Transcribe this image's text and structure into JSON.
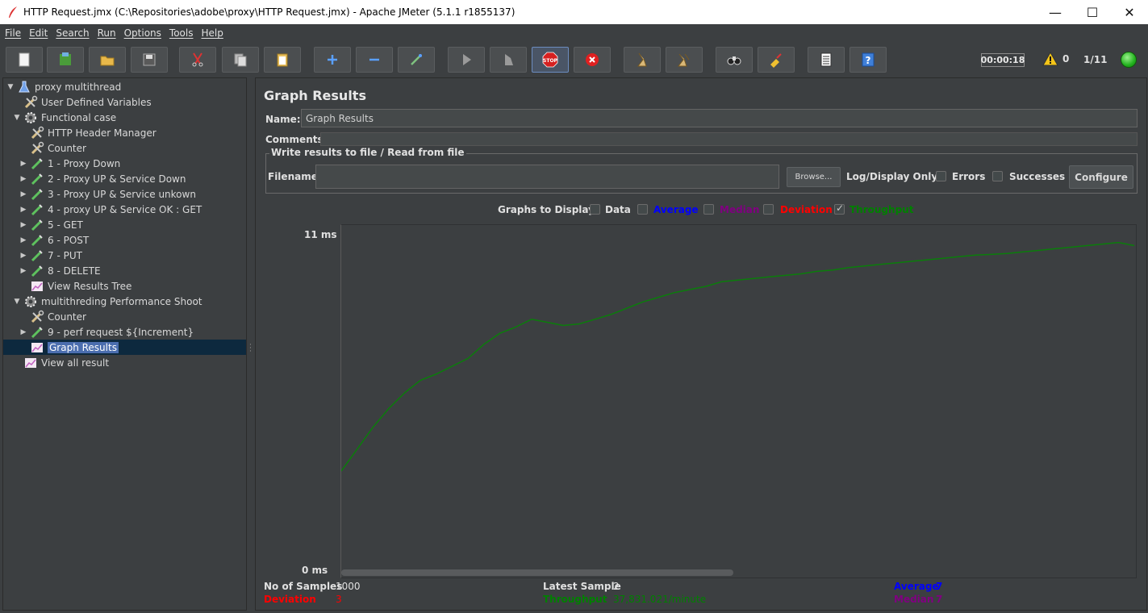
{
  "window": {
    "title": "HTTP Request.jmx (C:\\Repositories\\adobe\\proxy\\HTTP Request.jmx) - Apache JMeter (5.1.1 r1855137)",
    "minimize": "—",
    "maximize": "☐",
    "close": "✕"
  },
  "menu": [
    "File",
    "Edit",
    "Search",
    "Run",
    "Options",
    "Tools",
    "Help"
  ],
  "toolbar": {
    "buttons": [
      "new-icon",
      "templates-icon",
      "open-icon",
      "save-icon",
      "cut-icon",
      "copy-icon",
      "paste-icon",
      "expand-icon",
      "collapse-icon",
      "toggle-icon",
      "start-icon",
      "start-no-timers-icon",
      "stop-icon",
      "shutdown-icon",
      "clear-icon",
      "clear-all-icon",
      "search-icon",
      "reset-search-icon",
      "function-helper-icon",
      "help-icon"
    ],
    "timer": "00:00:18",
    "warnings": "0",
    "threads": "1/11"
  },
  "tree": [
    {
      "label": "proxy multithread",
      "level": 0,
      "toggle": "▼",
      "icon": "test-plan-icon"
    },
    {
      "label": "User Defined Variables",
      "level": 1,
      "toggle": "",
      "icon": "config-icon"
    },
    {
      "label": "Functional case",
      "level": 1,
      "toggle": "▼",
      "icon": "thread-group-icon"
    },
    {
      "label": "HTTP Header Manager",
      "level": 2,
      "toggle": "",
      "icon": "config-icon"
    },
    {
      "label": "Counter",
      "level": 2,
      "toggle": "",
      "icon": "config-icon"
    },
    {
      "label": "1 - Proxy Down",
      "level": 2,
      "toggle": "▶",
      "icon": "sampler-icon"
    },
    {
      "label": "2 - Proxy UP & Service Down",
      "level": 2,
      "toggle": "▶",
      "icon": "sampler-icon"
    },
    {
      "label": "3  - Proxy UP & Service unkown",
      "level": 2,
      "toggle": "▶",
      "icon": "sampler-icon"
    },
    {
      "label": "4 - proxy UP & Service OK : GET",
      "level": 2,
      "toggle": "▶",
      "icon": "sampler-icon"
    },
    {
      "label": "5 - GET",
      "level": 2,
      "toggle": "▶",
      "icon": "sampler-icon"
    },
    {
      "label": "6 - POST",
      "level": 2,
      "toggle": "▶",
      "icon": "sampler-icon"
    },
    {
      "label": "7  - PUT",
      "level": 2,
      "toggle": "▶",
      "icon": "sampler-icon"
    },
    {
      "label": "8 -  DELETE",
      "level": 2,
      "toggle": "▶",
      "icon": "sampler-icon"
    },
    {
      "label": "View Results Tree",
      "level": 2,
      "toggle": "",
      "icon": "listener-icon"
    },
    {
      "label": "multithreding Performance Shoot",
      "level": 1,
      "toggle": "▼",
      "icon": "thread-group-icon"
    },
    {
      "label": "Counter",
      "level": 2,
      "toggle": "",
      "icon": "config-icon"
    },
    {
      "label": "9 - perf request ${Increment}",
      "level": 2,
      "toggle": "▶",
      "icon": "sampler-icon"
    },
    {
      "label": "Graph Results",
      "level": 2,
      "toggle": "",
      "icon": "listener-icon",
      "selected": true
    },
    {
      "label": "View all result",
      "level": 1,
      "toggle": "",
      "icon": "listener-icon"
    }
  ],
  "panel": {
    "title": "Graph Results",
    "name_label": "Name:",
    "name_value": "Graph Results",
    "comments_label": "Comments:",
    "comments_value": "",
    "file_section_title": "Write results to file / Read from file",
    "filename_label": "Filename",
    "filename_value": "",
    "browse_label": "Browse...",
    "log_display_label": "Log/Display Only:",
    "errors_label": "Errors",
    "successes_label": "Successes",
    "configure_label": "Configure"
  },
  "graph_options": {
    "label": "Graphs to Display",
    "items": [
      {
        "label": "Data",
        "checked": false,
        "color": "#e0e0e0"
      },
      {
        "label": "Average",
        "checked": false,
        "color": "#0000ff"
      },
      {
        "label": "Median",
        "checked": false,
        "color": "#800080"
      },
      {
        "label": "Deviation",
        "checked": false,
        "color": "#ff0000"
      },
      {
        "label": "Throughput",
        "checked": true,
        "color": "#008000"
      }
    ]
  },
  "chart_data": {
    "type": "line",
    "ylabel_max": "11  ms",
    "ylabel_min": "0  ms",
    "ylim": [
      0,
      11
    ],
    "series": [
      {
        "name": "Throughput",
        "color": "#0b7d0b",
        "x": [
          0,
          2,
          4,
          6,
          8,
          10,
          12,
          14,
          16,
          18,
          20,
          22,
          24,
          26,
          28,
          30,
          32,
          34,
          36,
          38,
          40,
          42,
          44,
          46,
          48,
          50,
          52,
          54,
          56,
          58,
          60,
          62,
          64,
          66,
          68,
          70,
          72,
          74,
          76,
          78,
          80,
          82,
          84,
          86,
          88,
          90,
          92,
          94,
          96,
          98,
          100
        ],
        "y": [
          3.4,
          4.1,
          4.8,
          5.4,
          5.9,
          6.3,
          6.5,
          6.75,
          7.0,
          7.45,
          7.8,
          8.0,
          8.25,
          8.15,
          8.05,
          8.1,
          8.25,
          8.4,
          8.6,
          8.8,
          8.95,
          9.1,
          9.2,
          9.3,
          9.45,
          9.5,
          9.55,
          9.6,
          9.65,
          9.7,
          9.78,
          9.82,
          9.9,
          9.95,
          10.0,
          10.05,
          10.1,
          10.15,
          10.2,
          10.25,
          10.3,
          10.32,
          10.35,
          10.4,
          10.45,
          10.5,
          10.55,
          10.6,
          10.65,
          10.7,
          10.6
        ]
      }
    ]
  },
  "stats": {
    "samples_label": "No of Samples",
    "samples_value": "1000",
    "latest_label": "Latest Sample",
    "latest_value": "2",
    "average_label": "Average",
    "average_value": "7",
    "deviation_label": "Deviation",
    "deviation_value": "3",
    "throughput_label": "Throughput",
    "throughput_value": "37,831.021/minute",
    "median_label": "Median",
    "median_value": "7",
    "colors": {
      "average": "#0000ff",
      "deviation": "#ff0000",
      "throughput": "#008000",
      "median": "#800080"
    }
  }
}
